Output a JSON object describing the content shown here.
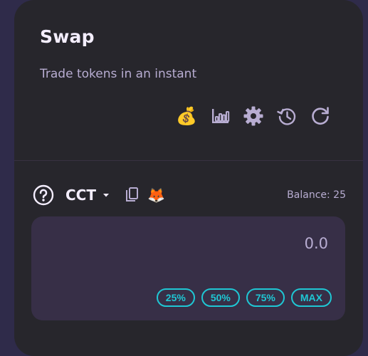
{
  "swap": {
    "title": "Swap",
    "subtitle": "Trade tokens in an instant"
  },
  "toolbar": {
    "icons": [
      "money-bag-icon",
      "chart-icon",
      "settings-gear-icon",
      "history-icon",
      "refresh-icon"
    ],
    "money_bag_emoji": "💰",
    "fox_emoji": "🦊"
  },
  "input": {
    "token": "CCT",
    "balance": "Balance: 25",
    "amount": "0.0",
    "quick_buttons": [
      "25%",
      "50%",
      "75%",
      "MAX"
    ]
  },
  "colors": {
    "background": "#2f2b4a",
    "card": "#27262c",
    "panel": "#372f47",
    "accent": "#1fc7d4",
    "text": "#f4eeff",
    "muted": "#b8add2"
  }
}
